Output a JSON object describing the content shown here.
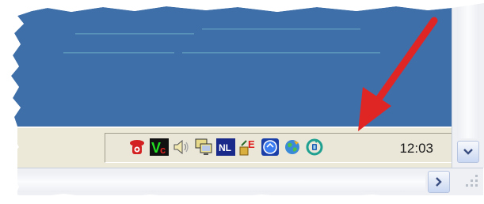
{
  "tray": {
    "icons": [
      {
        "name": "red-phone-icon",
        "color": "#cc1f1f"
      },
      {
        "name": "vc-icon",
        "text": "Vc"
      },
      {
        "name": "speaker-icon"
      },
      {
        "name": "network-monitor-icon"
      },
      {
        "name": "nl-icon",
        "text": "NL"
      },
      {
        "name": "red-e-app-icon",
        "text": "E"
      },
      {
        "name": "blue-circle-icon"
      },
      {
        "name": "globe-icon"
      },
      {
        "name": "update-sync-icon"
      }
    ],
    "clock": "12:03"
  },
  "colors": {
    "desktop": "#3f6fa8",
    "arrow": "#e02525",
    "taskbar": "#ece9d8"
  },
  "scrollbars": {
    "vertical_button": "chevron-down-icon",
    "horizontal_button": "chevron-right-icon"
  }
}
